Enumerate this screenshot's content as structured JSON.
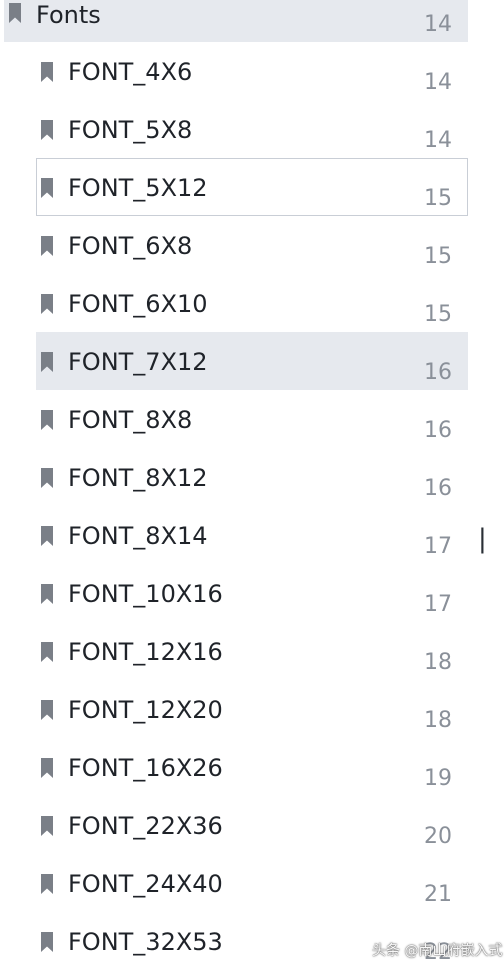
{
  "bookmarks": {
    "parent": {
      "label": "Fonts",
      "page": "14"
    },
    "children": [
      {
        "label": "FONT_4X6",
        "page": "14"
      },
      {
        "label": "FONT_5X8",
        "page": "14"
      },
      {
        "label": "FONT_5X12",
        "page": "15"
      },
      {
        "label": "FONT_6X8",
        "page": "15"
      },
      {
        "label": "FONT_6X10",
        "page": "15"
      },
      {
        "label": "FONT_7X12",
        "page": "16"
      },
      {
        "label": "FONT_8X8",
        "page": "16"
      },
      {
        "label": "FONT_8X12",
        "page": "16"
      },
      {
        "label": "FONT_8X14",
        "page": "17"
      },
      {
        "label": "FONT_10X16",
        "page": "17"
      },
      {
        "label": "FONT_12X16",
        "page": "18"
      },
      {
        "label": "FONT_12X20",
        "page": "18"
      },
      {
        "label": "FONT_16X26",
        "page": "19"
      },
      {
        "label": "FONT_22X36",
        "page": "20"
      },
      {
        "label": "FONT_24X40",
        "page": "21"
      },
      {
        "label": "FONT_32X53",
        "page": "22"
      }
    ]
  },
  "edge_glyph": "|",
  "watermark": "头条 @南山府嵌入式",
  "icons": {
    "bookmark": "bookmark-icon"
  },
  "colors": {
    "row_highlight": "#e6e9ee",
    "focus_border": "#c9ced6",
    "label_text": "#1f2329",
    "page_text": "#8a9099",
    "bookmark_icon": "#7a7f87"
  }
}
